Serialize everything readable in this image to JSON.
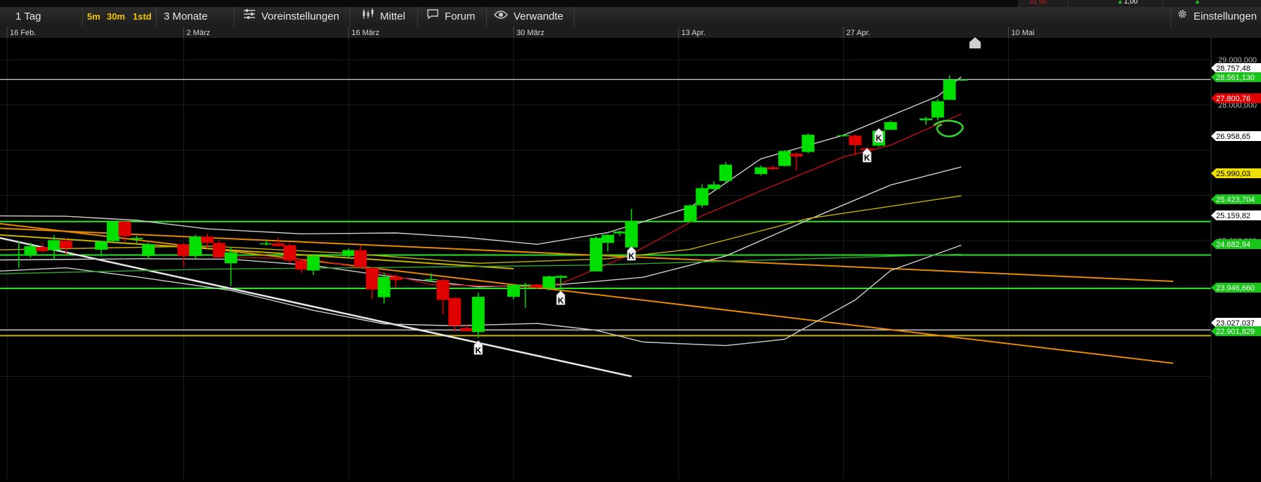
{
  "header_strip": {
    "value_red": "31,90",
    "value_white": "1,00"
  },
  "toolbar": {
    "interval": "1 Tag",
    "quick": [
      "5m",
      "30m",
      "1std"
    ],
    "range": "3 Monate",
    "presets": "Voreinstellungen",
    "indicator": "Mittel",
    "forum": "Forum",
    "related": "Verwandte",
    "settings": "Einstellungen"
  },
  "icons": [
    "sliders-icon",
    "candle-chart-icon",
    "speech-bubble-icon",
    "eye-icon",
    "gear-icon",
    "home-arrow-icon"
  ],
  "colors": {
    "up": "#00e000",
    "down": "#e00000",
    "bollinger": "#cfcfcf",
    "ma_red": "#c01010",
    "ma_yellow": "#c8b400",
    "ma_green": "#2fa82f",
    "trend_orange": "#e68a00",
    "support_green": "#22e822"
  },
  "chart_data": {
    "type": "candlestick",
    "xlabel": "",
    "ylabel": "",
    "x_ticks": [
      "16 Feb.",
      "2 März",
      "16 März",
      "30 März",
      "13 Apr.",
      "27 Apr.",
      "10 Mai"
    ],
    "y_ticks": [
      "29.000,000",
      "28.000,000",
      "25.000,000"
    ],
    "ylim": [
      22000,
      29600
    ],
    "grid": true,
    "price_labels": [
      {
        "text": "28.757,48",
        "value": 28757,
        "style": "white"
      },
      {
        "text": "28.561,130",
        "value": 28561,
        "style": "green"
      },
      {
        "text": "27.800,76",
        "value": 27800,
        "style": "red"
      },
      {
        "text": "26.958,65",
        "value": 26958,
        "style": "white"
      },
      {
        "text": "25.990,03",
        "value": 25990,
        "style": "yellow"
      },
      {
        "text": "25.423,704",
        "value": 25423,
        "style": "green"
      },
      {
        "text": "25.159,82",
        "value": 25159,
        "style": "white"
      },
      {
        "text": "24.682,94",
        "value": 24682,
        "style": "green"
      },
      {
        "text": "23.946,660",
        "value": 23946,
        "style": "green"
      },
      {
        "text": "23.027,037",
        "value": 23027,
        "style": "white"
      },
      {
        "text": "22.901,829",
        "value": 22901,
        "style": "green"
      }
    ],
    "candles": [
      {
        "date": "2020-02-14",
        "o": 24720,
        "h": 24760,
        "l": 24680,
        "c": 24720
      },
      {
        "date": "2020-02-17",
        "o": 24700,
        "h": 24980,
        "l": 24400,
        "c": 24700
      },
      {
        "date": "2020-02-18",
        "o": 24700,
        "h": 24950,
        "l": 24620,
        "c": 24880
      },
      {
        "date": "2020-02-19",
        "o": 24860,
        "h": 24950,
        "l": 24740,
        "c": 24770
      },
      {
        "date": "2020-02-20",
        "o": 24790,
        "h": 25120,
        "l": 24580,
        "c": 25010
      },
      {
        "date": "2020-02-21",
        "o": 25000,
        "h": 25040,
        "l": 24690,
        "c": 24830
      },
      {
        "date": "2020-02-24",
        "o": 24800,
        "h": 25000,
        "l": 24650,
        "c": 24980
      },
      {
        "date": "2020-02-25",
        "o": 24990,
        "h": 25430,
        "l": 24980,
        "c": 25420
      },
      {
        "date": "2020-02-26",
        "o": 25420,
        "h": 25440,
        "l": 24980,
        "c": 25100
      },
      {
        "date": "2020-02-27",
        "o": 25030,
        "h": 25110,
        "l": 24950,
        "c": 25060
      },
      {
        "date": "2020-02-28",
        "o": 24660,
        "h": 24950,
        "l": 24590,
        "c": 24920
      },
      {
        "date": "2020-03-02",
        "o": 24920,
        "h": 24950,
        "l": 24420,
        "c": 24660
      },
      {
        "date": "2020-03-03",
        "o": 24660,
        "h": 25130,
        "l": 24590,
        "c": 25090
      },
      {
        "date": "2020-03-04",
        "o": 25090,
        "h": 25150,
        "l": 24830,
        "c": 24950
      },
      {
        "date": "2020-03-05",
        "o": 24950,
        "h": 25010,
        "l": 24620,
        "c": 24630
      },
      {
        "date": "2020-03-06",
        "o": 24500,
        "h": 24860,
        "l": 24000,
        "c": 24740
      },
      {
        "date": "2020-03-09",
        "o": 24920,
        "h": 25010,
        "l": 24890,
        "c": 24940
      },
      {
        "date": "2020-03-10",
        "o": 24940,
        "h": 25060,
        "l": 24870,
        "c": 24880
      },
      {
        "date": "2020-03-11",
        "o": 24900,
        "h": 24930,
        "l": 24500,
        "c": 24560
      },
      {
        "date": "2020-03-12",
        "o": 24560,
        "h": 24590,
        "l": 24290,
        "c": 24360
      },
      {
        "date": "2020-03-13",
        "o": 24340,
        "h": 24690,
        "l": 24240,
        "c": 24660
      },
      {
        "date": "2020-03-16",
        "o": 24660,
        "h": 24830,
        "l": 24620,
        "c": 24790
      },
      {
        "date": "2020-03-17",
        "o": 24790,
        "h": 24890,
        "l": 24380,
        "c": 24410
      },
      {
        "date": "2020-03-18",
        "o": 24400,
        "h": 24420,
        "l": 23710,
        "c": 23920
      },
      {
        "date": "2020-03-19",
        "o": 23750,
        "h": 24290,
        "l": 23610,
        "c": 24200
      },
      {
        "date": "2020-03-20",
        "o": 24200,
        "h": 24260,
        "l": 23960,
        "c": 24130
      },
      {
        "date": "2020-03-23",
        "o": 24130,
        "h": 24280,
        "l": 24080,
        "c": 24150
      },
      {
        "date": "2020-03-24",
        "o": 24130,
        "h": 24160,
        "l": 23370,
        "c": 23690
      },
      {
        "date": "2020-03-25",
        "o": 23730,
        "h": 23750,
        "l": 22990,
        "c": 23120
      },
      {
        "date": "2020-03-26",
        "o": 23070,
        "h": 23150,
        "l": 23000,
        "c": 23000
      },
      {
        "date": "2020-03-27",
        "o": 22980,
        "h": 23850,
        "l": 22850,
        "c": 23760
      },
      {
        "date": "2020-03-30",
        "o": 23760,
        "h": 24040,
        "l": 23700,
        "c": 24020
      },
      {
        "date": "2020-03-31",
        "o": 24030,
        "h": 24070,
        "l": 23520,
        "c": 24030
      },
      {
        "date": "2020-04-01",
        "o": 24030,
        "h": 24040,
        "l": 23940,
        "c": 23960
      },
      {
        "date": "2020-04-02",
        "o": 23950,
        "h": 24230,
        "l": 23900,
        "c": 24210
      },
      {
        "date": "2020-04-03",
        "o": 24180,
        "h": 24240,
        "l": 23840,
        "c": 24220
      },
      {
        "date": "2020-04-06",
        "o": 24320,
        "h": 25100,
        "l": 24320,
        "c": 25060
      },
      {
        "date": "2020-04-07",
        "o": 24950,
        "h": 25140,
        "l": 24760,
        "c": 25130
      },
      {
        "date": "2020-04-08",
        "o": 25160,
        "h": 25220,
        "l": 25100,
        "c": 25200
      },
      {
        "date": "2020-04-09",
        "o": 24850,
        "h": 25700,
        "l": 24820,
        "c": 25430
      },
      {
        "date": "2020-04-14",
        "o": 25430,
        "h": 25800,
        "l": 25400,
        "c": 25780
      },
      {
        "date": "2020-04-15",
        "o": 25780,
        "h": 26240,
        "l": 25730,
        "c": 26160
      },
      {
        "date": "2020-04-16",
        "o": 26140,
        "h": 26310,
        "l": 26120,
        "c": 26240
      },
      {
        "date": "2020-04-17",
        "o": 26320,
        "h": 26740,
        "l": 26260,
        "c": 26680
      },
      {
        "date": "2020-04-20",
        "o": 26470,
        "h": 26660,
        "l": 26440,
        "c": 26620
      },
      {
        "date": "2020-04-21",
        "o": 26620,
        "h": 26660,
        "l": 26550,
        "c": 26580
      },
      {
        "date": "2020-04-22",
        "o": 26650,
        "h": 27000,
        "l": 26640,
        "c": 26980
      },
      {
        "date": "2020-04-23",
        "o": 26920,
        "h": 26950,
        "l": 26540,
        "c": 26860
      },
      {
        "date": "2020-04-24",
        "o": 26960,
        "h": 27370,
        "l": 26930,
        "c": 27340
      },
      {
        "date": "2020-04-27",
        "o": 27330,
        "h": 27350,
        "l": 27300,
        "c": 27330
      },
      {
        "date": "2020-04-28",
        "o": 27320,
        "h": 27340,
        "l": 26880,
        "c": 27110
      },
      {
        "date": "2020-04-29",
        "o": 27040,
        "h": 27070,
        "l": 26980,
        "c": 27000
      },
      {
        "date": "2020-04-30",
        "o": 27100,
        "h": 27460,
        "l": 27080,
        "c": 27430
      },
      {
        "date": "2020-05-01",
        "o": 27450,
        "h": 27650,
        "l": 27440,
        "c": 27620
      },
      {
        "date": "2020-05-04",
        "o": 27660,
        "h": 27740,
        "l": 27560,
        "c": 27700
      },
      {
        "date": "2020-05-05",
        "o": 27720,
        "h": 28130,
        "l": 27660,
        "c": 28080
      },
      {
        "date": "2020-05-06",
        "o": 28110,
        "h": 28650,
        "l": 28110,
        "c": 28560
      },
      {
        "date": "2020-05-07",
        "o": 28560,
        "h": 28560,
        "l": 28560,
        "c": 28560
      }
    ],
    "k_markers": [
      {
        "date": "2020-03-27",
        "value": 22700
      },
      {
        "date": "2020-04-03",
        "value": 23800
      },
      {
        "date": "2020-04-09",
        "value": 24780
      },
      {
        "date": "2020-04-29",
        "value": 26950
      },
      {
        "date": "2020-04-30",
        "value": 27390
      }
    ],
    "horizontal_lines": [
      {
        "value": 28561,
        "color": "white"
      },
      {
        "value": 25423,
        "color": "green"
      },
      {
        "value": 24682,
        "color": "green"
      },
      {
        "value": 23946,
        "color": "green"
      },
      {
        "value": 23027,
        "color": "white"
      },
      {
        "value": 22901,
        "color": "yellow"
      }
    ],
    "trend_lines": [
      {
        "color": "orange",
        "from": {
          "date": "2020-02-14",
          "value": 25420
        },
        "to": {
          "date": "2020-05-25",
          "value": 22290
        }
      },
      {
        "color": "orange",
        "from": {
          "date": "2020-02-14",
          "value": 25290
        },
        "to": {
          "date": "2020-05-25",
          "value": 24100
        }
      },
      {
        "color": "yellow",
        "from": {
          "date": "2020-02-14",
          "value": 25150
        },
        "to": {
          "date": "2020-03-30",
          "value": 24380
        }
      },
      {
        "color": "white",
        "from": {
          "date": "2020-02-14",
          "value": 25140
        },
        "to": {
          "date": "2020-04-09",
          "value": 22000
        }
      }
    ],
    "series": [
      {
        "role": "bollinger_upper",
        "color": "white",
        "points": [
          [
            "2020-02-14",
            25550
          ],
          [
            "2020-02-21",
            25540
          ],
          [
            "2020-02-27",
            25450
          ],
          [
            "2020-03-04",
            25260
          ],
          [
            "2020-03-12",
            25150
          ],
          [
            "2020-03-20",
            25170
          ],
          [
            "2020-03-26",
            25070
          ],
          [
            "2020-04-01",
            24920
          ],
          [
            "2020-04-07",
            25180
          ],
          [
            "2020-04-14",
            25740
          ],
          [
            "2020-04-20",
            26810
          ],
          [
            "2020-04-27",
            27330
          ],
          [
            "2020-05-05",
            28190
          ],
          [
            "2020-05-07",
            28620
          ]
        ]
      },
      {
        "role": "bollinger_middle",
        "color": "white",
        "points": [
          [
            "2020-02-14",
            24570
          ],
          [
            "2020-02-27",
            24600
          ],
          [
            "2020-03-06",
            24590
          ],
          [
            "2020-03-13",
            24450
          ],
          [
            "2020-03-20",
            24190
          ],
          [
            "2020-03-27",
            23980
          ],
          [
            "2020-04-03",
            24030
          ],
          [
            "2020-04-10",
            24190
          ],
          [
            "2020-04-17",
            24660
          ],
          [
            "2020-04-24",
            25460
          ],
          [
            "2020-05-01",
            26230
          ],
          [
            "2020-05-07",
            26630
          ]
        ]
      },
      {
        "role": "bollinger_lower",
        "color": "white",
        "points": [
          [
            "2020-02-14",
            24310
          ],
          [
            "2020-02-21",
            24400
          ],
          [
            "2020-02-27",
            24200
          ],
          [
            "2020-03-06",
            23900
          ],
          [
            "2020-03-13",
            23460
          ],
          [
            "2020-03-19",
            23160
          ],
          [
            "2020-03-25",
            23120
          ],
          [
            "2020-04-01",
            23170
          ],
          [
            "2020-04-06",
            23020
          ],
          [
            "2020-04-10",
            22760
          ],
          [
            "2020-04-17",
            22680
          ],
          [
            "2020-04-22",
            22820
          ],
          [
            "2020-04-28",
            23690
          ],
          [
            "2020-05-01",
            24340
          ],
          [
            "2020-05-07",
            24900
          ]
        ]
      },
      {
        "role": "moving_average_short",
        "color": "red",
        "points": [
          [
            "2020-03-06",
            24640
          ],
          [
            "2020-03-13",
            24580
          ],
          [
            "2020-03-17",
            24400
          ],
          [
            "2020-03-23",
            24030
          ],
          [
            "2020-03-31",
            23980
          ],
          [
            "2020-04-03",
            24050
          ],
          [
            "2020-04-09",
            24700
          ],
          [
            "2020-04-15",
            25550
          ],
          [
            "2020-04-20",
            26100
          ],
          [
            "2020-04-27",
            26850
          ],
          [
            "2020-05-01",
            27110
          ],
          [
            "2020-05-07",
            27800
          ]
        ]
      },
      {
        "role": "moving_average_mid",
        "color": "yellow",
        "points": [
          [
            "2020-02-14",
            24790
          ],
          [
            "2020-03-04",
            24880
          ],
          [
            "2020-03-16",
            24720
          ],
          [
            "2020-03-27",
            24500
          ],
          [
            "2020-04-07",
            24600
          ],
          [
            "2020-04-14",
            24810
          ],
          [
            "2020-04-24",
            25490
          ],
          [
            "2020-05-07",
            25990
          ]
        ]
      },
      {
        "role": "moving_average_long",
        "color": "green",
        "points": [
          [
            "2020-02-14",
            24260
          ],
          [
            "2020-03-04",
            24370
          ],
          [
            "2020-03-20",
            24410
          ],
          [
            "2020-04-06",
            24460
          ],
          [
            "2020-04-24",
            24600
          ],
          [
            "2020-05-07",
            24700
          ]
        ]
      }
    ]
  }
}
